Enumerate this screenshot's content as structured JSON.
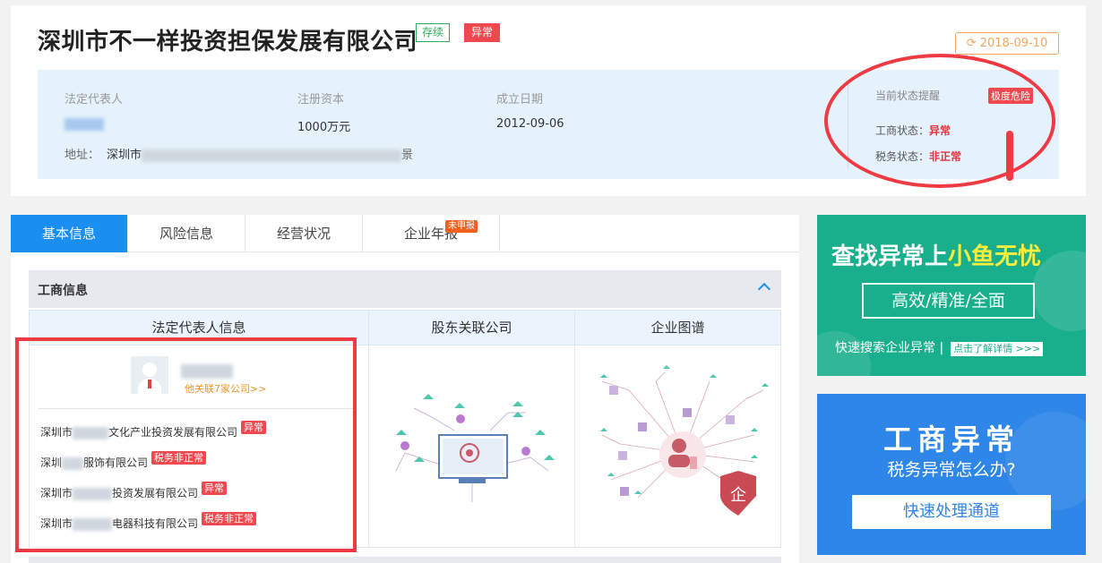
{
  "company": {
    "name": "深圳市不一样投资担保发展有限公司",
    "status_badge": "存续",
    "abnormal_badge": "异常",
    "update_date": "2018-09-10"
  },
  "info": {
    "legal_rep_label": "法定代表人",
    "capital_label": "注册资本",
    "capital_value": "1000万元",
    "founded_label": "成立日期",
    "founded_value": "2012-09-06",
    "address_label": "地址：",
    "address_prefix": "深圳市",
    "address_suffix": "景"
  },
  "status": {
    "title": "当前状态提醒",
    "danger": "极度危险",
    "biz_label": "工商状态：",
    "biz_value": "异常",
    "tax_label": "税务状态：",
    "tax_value": "非正常"
  },
  "tabs": [
    {
      "label": "基本信息"
    },
    {
      "label": "风险信息"
    },
    {
      "label": "经营状况"
    },
    {
      "label": "企业年报",
      "badge": "未申报"
    }
  ],
  "section": {
    "title": "工商信息",
    "columns": [
      "法定代表人信息",
      "股东关联公司",
      "企业图谱"
    ]
  },
  "person": {
    "link": "他关联7家公司>>"
  },
  "companies": [
    {
      "prefix": "深圳市",
      "suffix": "文化产业投资发展有限公司",
      "tag": "异常"
    },
    {
      "prefix": "深圳",
      "suffix": "服饰有限公司",
      "tag": "税务非正常"
    },
    {
      "prefix": "深圳市",
      "suffix": "投资发展有限公司",
      "tag": "异常"
    },
    {
      "prefix": "深圳市",
      "suffix": "电器科技有限公司",
      "tag": "税务非正常"
    }
  ],
  "graph_badge": "企",
  "ads": {
    "ad1_title_a": "查找异常上",
    "ad1_title_b": "小鱼无忧",
    "ad1_box": "高效/精准/全面",
    "ad1_foot": "快速搜索企业异常",
    "ad1_sep": "|",
    "ad1_btn": "点击了解详情 >>>",
    "ad2_title": "工商异常",
    "ad2_sub": "税务异常怎么办?",
    "ad2_btn": "快速处理通道"
  },
  "colors": {
    "primary": "#1a8ef1",
    "danger": "#f0484f",
    "ok": "#2fae5a",
    "ad_green": "#1aaf8c",
    "ad_blue": "#2e86e8"
  }
}
